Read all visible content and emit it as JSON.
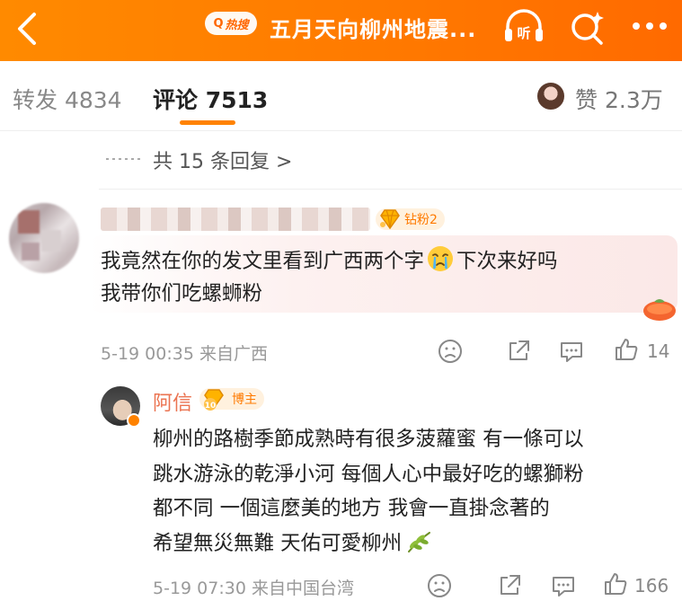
{
  "topbar": {
    "hot_tag": "热搜",
    "title": "五月天向柳州地震...",
    "listen_label": "听"
  },
  "tabs": {
    "repost_label": "转发",
    "repost_count": "4834",
    "comment_label": "评论",
    "comment_count": "7513",
    "like_label": "赞",
    "like_count": "2.3万"
  },
  "replies_summary": "共 15 条回复 >",
  "comment": {
    "badge": "钻粉2",
    "text_line1_a": "我竟然在你的发文里看到广西两个字",
    "text_line1_b": "下次来好吗",
    "text_line2": "我带你们吃螺蛳粉",
    "time": "5-19 00:35",
    "location": "来自广西",
    "like_count": "14"
  },
  "reply": {
    "author": "阿信",
    "badge_level": "10",
    "badge": "博主",
    "lines": [
      "柳州的路樹季節成熟時有很多菠蘿蜜  有一條可以",
      "跳水游泳的乾淨小河  每個人心中最好吃的螺獅粉",
      "都不同  一個這麼美的地方  我會一直掛念著的",
      "希望無災無難  天佑可愛柳州"
    ],
    "time": "5-19 07:30",
    "location": "来自中国台湾",
    "like_count": "166"
  },
  "colors": {
    "accent": "#ff8200",
    "topbar": "#ff7a00",
    "reply_name": "#eb7350",
    "meta": "#999999"
  },
  "icons": [
    "back-icon",
    "search-icon",
    "listen-icon",
    "more-icon",
    "dislike-icon",
    "share-icon",
    "comment-icon",
    "thumbs-up-icon"
  ]
}
